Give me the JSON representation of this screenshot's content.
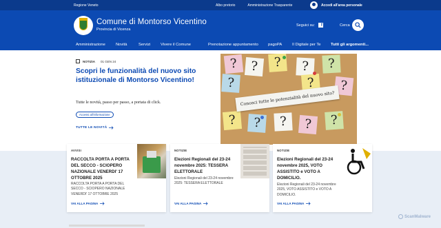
{
  "slim_header": {
    "region": "Regione Veneto",
    "links": [
      "Albo pretorio",
      "Amministrazione Trasparente"
    ],
    "login": "Accedi all'area personale"
  },
  "header": {
    "title": "Comune di Montorso Vicentino",
    "subtitle": "Provincia di Vicenza",
    "social_label": "Seguici su:",
    "search_label": "Cerca"
  },
  "nav": {
    "items": [
      "Amministrazione",
      "Novità",
      "Servizi",
      "Vivere il Comune"
    ],
    "secondary": [
      "Prenotazione appuntamento",
      "pagoPA",
      "Il Digitale per Te"
    ],
    "all_topics": "Tutti gli argomenti..."
  },
  "hero": {
    "tag": "NOTIZIA",
    "date": "01 GEN 24",
    "title": "Scopri le funzionalità del nuovo sito istituzionale di Montorso Vicentino!",
    "description": "Tutte le novità, passo per passo, a portata di click.",
    "chip": "Accessi all'informazione",
    "all_news": "TUTTE LE NOVITÀ",
    "image_banner": "Conosci tutte le potenzialità del nuovo sito?"
  },
  "cards": [
    {
      "category": "AVVISI",
      "title": "RACCOLTA PORTA A PORTA DEL SECCO - SCIOPERO NAZIONALE VENERDI' 17 OTTOBRE 2025",
      "description": "RACCOLTA PORTA A PORTA DEL SECCO - SCIOPERO NAZIONALE VENERDI' 17 OTTOBRE 2025",
      "link": "VAI ALLA PAGINA"
    },
    {
      "category": "NOTIZIE",
      "title": "Elezioni Regionali del 23-24 novembre 2025: TESSERA ELETTORALE",
      "description": "Elezioni Regionali del 23-24 novembre 2025: TESSERA ELETTORALE",
      "link": "VAI ALLA PAGINA"
    },
    {
      "category": "NOTIZIE",
      "title": "Elezioni Regionali del 23-24 novembre 2025, VOTO ASSISTITO e VOTO A DOMICILIO.",
      "description": "Elezioni Regionali del 23-24 novembre 2025, VOTO ASSISTITO e VOTO A DOMICILIO.",
      "link": "VAI ALLA PAGINA"
    }
  ],
  "watermark": "ScanMalware",
  "colors": {
    "primary": "#0c4ab3",
    "slim": "#0b3a8c",
    "cards_bg": "#e8eef6"
  }
}
